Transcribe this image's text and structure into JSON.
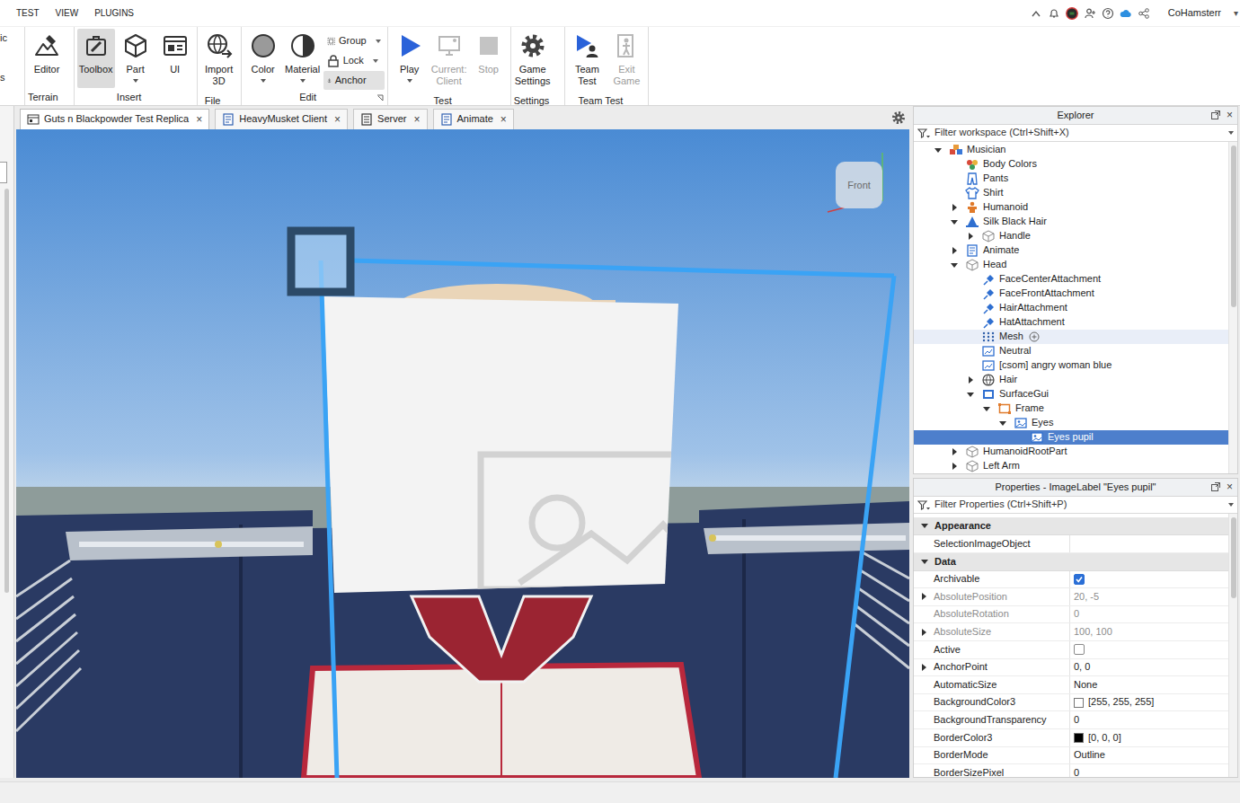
{
  "menu_bar": {
    "items": [
      "TEST",
      "VIEW",
      "PLUGINS"
    ],
    "user": "CoHamsterr",
    "user_caret": "▾"
  },
  "ribbon": {
    "cut_group": {
      "top": "ic",
      "bottom": "s"
    },
    "groups": [
      {
        "label": "Terrain",
        "launcher": false,
        "tools": [
          {
            "kind": "terrain",
            "lines": [
              "Editor"
            ],
            "selected": false,
            "disabled": false,
            "dropdown": false
          }
        ]
      },
      {
        "label": "Insert",
        "launcher": false,
        "tools": [
          {
            "kind": "toolbox",
            "lines": [
              "Toolbox"
            ],
            "selected": true,
            "disabled": false,
            "dropdown": false
          },
          {
            "kind": "part",
            "lines": [
              "Part"
            ],
            "selected": false,
            "disabled": false,
            "dropdown": true
          },
          {
            "kind": "ui",
            "lines": [
              "UI"
            ],
            "selected": false,
            "disabled": false,
            "dropdown": false
          }
        ]
      },
      {
        "label": "File",
        "launcher": false,
        "tools": [
          {
            "kind": "import",
            "lines": [
              "Import",
              "3D"
            ],
            "selected": false,
            "disabled": false,
            "dropdown": false
          }
        ]
      },
      {
        "label": "Edit",
        "launcher": true,
        "tools": [
          {
            "kind": "color",
            "lines": [
              "Color"
            ],
            "selected": false,
            "disabled": false,
            "dropdown": true
          },
          {
            "kind": "material",
            "lines": [
              "Material"
            ],
            "selected": false,
            "disabled": false,
            "dropdown": true
          }
        ],
        "small_tools": [
          {
            "kind": "group",
            "label": "Group",
            "selected": false,
            "dropdown": true
          },
          {
            "kind": "lock",
            "label": "Lock",
            "selected": false,
            "dropdown": true
          },
          {
            "kind": "anchor",
            "label": "Anchor",
            "selected": true,
            "dropdown": false
          }
        ]
      },
      {
        "label": "Test",
        "launcher": false,
        "tools": [
          {
            "kind": "play",
            "lines": [
              "Play"
            ],
            "selected": false,
            "disabled": false,
            "dropdown": true
          },
          {
            "kind": "client",
            "lines": [
              "Current:",
              "Client"
            ],
            "selected": false,
            "disabled": true,
            "dropdown": false
          },
          {
            "kind": "stop",
            "lines": [
              "Stop"
            ],
            "selected": false,
            "disabled": true,
            "dropdown": false
          }
        ]
      },
      {
        "label": "Settings",
        "launcher": false,
        "tools": [
          {
            "kind": "settings",
            "lines": [
              "Game",
              "Settings"
            ],
            "selected": false,
            "disabled": false,
            "dropdown": false
          }
        ]
      },
      {
        "label": "Team Test",
        "launcher": false,
        "tools": [
          {
            "kind": "teamtest",
            "lines": [
              "Team",
              "Test"
            ],
            "selected": false,
            "disabled": false,
            "dropdown": false
          },
          {
            "kind": "exit",
            "lines": [
              "Exit",
              "Game"
            ],
            "selected": false,
            "disabled": true,
            "dropdown": false
          }
        ]
      }
    ]
  },
  "doc_tabs": {
    "close": "×",
    "items": [
      {
        "label": "Guts n Blackpowder Test Replica",
        "kind": "place",
        "selected": true
      },
      {
        "label": "HeavyMusket Client",
        "kind": "script",
        "selected": false
      },
      {
        "label": "Server",
        "kind": "doc",
        "selected": false
      },
      {
        "label": "Animate",
        "kind": "script",
        "selected": false
      }
    ]
  },
  "viewport": {
    "view_cube": "Front"
  },
  "explorer": {
    "title": "Explorer",
    "close": "×",
    "filter_placeholder": "Filter workspace (Ctrl+Shift+X)",
    "items": [
      {
        "label": "Musician",
        "kind": "model",
        "depth": 0,
        "expandable": true,
        "expanded": true,
        "selected": false,
        "hovered": false
      },
      {
        "label": "Body Colors",
        "kind": "bodycolors",
        "depth": 1,
        "expandable": false,
        "expanded": false,
        "selected": false,
        "hovered": false
      },
      {
        "label": "Pants",
        "kind": "pants",
        "depth": 1,
        "expandable": false,
        "expanded": false,
        "selected": false,
        "hovered": false
      },
      {
        "label": "Shirt",
        "kind": "shirt",
        "depth": 1,
        "expandable": false,
        "expanded": false,
        "selected": false,
        "hovered": false
      },
      {
        "label": "Humanoid",
        "kind": "humanoid",
        "depth": 1,
        "expandable": true,
        "expanded": false,
        "selected": false,
        "hovered": false
      },
      {
        "label": "Silk Black Hair",
        "kind": "accessory",
        "depth": 1,
        "expandable": true,
        "expanded": true,
        "selected": false,
        "hovered": false
      },
      {
        "label": "Handle",
        "kind": "part",
        "depth": 2,
        "expandable": true,
        "expanded": false,
        "selected": false,
        "hovered": false
      },
      {
        "label": "Animate",
        "kind": "script",
        "depth": 1,
        "expandable": true,
        "expanded": false,
        "selected": false,
        "hovered": false
      },
      {
        "label": "Head",
        "kind": "part",
        "depth": 1,
        "expandable": true,
        "expanded": true,
        "selected": false,
        "hovered": false
      },
      {
        "label": "FaceCenterAttachment",
        "kind": "attachment",
        "depth": 2,
        "expandable": false,
        "expanded": false,
        "selected": false,
        "hovered": false
      },
      {
        "label": "FaceFrontAttachment",
        "kind": "attachment",
        "depth": 2,
        "expandable": false,
        "expanded": false,
        "selected": false,
        "hovered": false
      },
      {
        "label": "HairAttachment",
        "kind": "attachment",
        "depth": 2,
        "expandable": false,
        "expanded": false,
        "selected": false,
        "hovered": false
      },
      {
        "label": "HatAttachment",
        "kind": "attachment",
        "depth": 2,
        "expandable": false,
        "expanded": false,
        "selected": false,
        "hovered": false
      },
      {
        "label": "Mesh",
        "kind": "mesh",
        "depth": 2,
        "expandable": false,
        "expanded": false,
        "selected": false,
        "hovered": true
      },
      {
        "label": "Neutral",
        "kind": "decal",
        "depth": 2,
        "expandable": false,
        "expanded": false,
        "selected": false,
        "hovered": false
      },
      {
        "label": "[csom] angry woman blue",
        "kind": "decal",
        "depth": 2,
        "expandable": false,
        "expanded": false,
        "selected": false,
        "hovered": false
      },
      {
        "label": "Hair",
        "kind": "globe",
        "depth": 2,
        "expandable": true,
        "expanded": false,
        "selected": false,
        "hovered": false
      },
      {
        "label": "SurfaceGui",
        "kind": "gui",
        "depth": 2,
        "expandable": true,
        "expanded": true,
        "selected": false,
        "hovered": false
      },
      {
        "label": "Frame",
        "kind": "frame",
        "depth": 3,
        "expandable": true,
        "expanded": true,
        "selected": false,
        "hovered": false
      },
      {
        "label": "Eyes",
        "kind": "image",
        "depth": 4,
        "expandable": true,
        "expanded": true,
        "selected": false,
        "hovered": false
      },
      {
        "label": "Eyes pupil",
        "kind": "image",
        "depth": 5,
        "expandable": false,
        "expanded": false,
        "selected": true,
        "hovered": false
      },
      {
        "label": "HumanoidRootPart",
        "kind": "part",
        "depth": 1,
        "expandable": true,
        "expanded": false,
        "selected": false,
        "hovered": false
      },
      {
        "label": "Left Arm",
        "kind": "part",
        "depth": 1,
        "expandable": true,
        "expanded": false,
        "selected": false,
        "hovered": false
      }
    ]
  },
  "properties": {
    "title": "Properties - ImageLabel \"Eyes pupil\"",
    "close": "×",
    "filter_placeholder": "Filter Properties (Ctrl+Shift+P)",
    "sections": [
      {
        "label": "Appearance",
        "expanded": true,
        "rows": [
          {
            "name": "SelectionImageObject",
            "kind": "text",
            "value": "",
            "readonly": false,
            "expandable": false
          }
        ]
      },
      {
        "label": "Data",
        "expanded": true,
        "rows": [
          {
            "name": "Archivable",
            "kind": "check",
            "checked": true,
            "readonly": false,
            "expandable": false
          },
          {
            "name": "AbsolutePosition",
            "kind": "text",
            "value": "20, -5",
            "readonly": true,
            "expandable": true
          },
          {
            "name": "AbsoluteRotation",
            "kind": "text",
            "value": "0",
            "readonly": true,
            "expandable": false
          },
          {
            "name": "AbsoluteSize",
            "kind": "text",
            "value": "100, 100",
            "readonly": true,
            "expandable": true
          },
          {
            "name": "Active",
            "kind": "check",
            "checked": false,
            "readonly": false,
            "expandable": false
          },
          {
            "name": "AnchorPoint",
            "kind": "text",
            "value": "0, 0",
            "readonly": false,
            "expandable": true
          },
          {
            "name": "AutomaticSize",
            "kind": "text",
            "value": "None",
            "readonly": false,
            "expandable": false
          },
          {
            "name": "BackgroundColor3",
            "kind": "color",
            "color": "#ffffff",
            "value": "[255, 255, 255]",
            "readonly": false,
            "expandable": false
          },
          {
            "name": "BackgroundTransparency",
            "kind": "text",
            "value": "0",
            "readonly": false,
            "expandable": false
          },
          {
            "name": "BorderColor3",
            "kind": "color",
            "color": "#000000",
            "value": "[0, 0, 0]",
            "readonly": false,
            "expandable": false
          },
          {
            "name": "BorderMode",
            "kind": "text",
            "value": "Outline",
            "readonly": false,
            "expandable": false
          },
          {
            "name": "BorderSizePixel",
            "kind": "text",
            "value": "0",
            "readonly": false,
            "expandable": false
          }
        ]
      }
    ]
  }
}
